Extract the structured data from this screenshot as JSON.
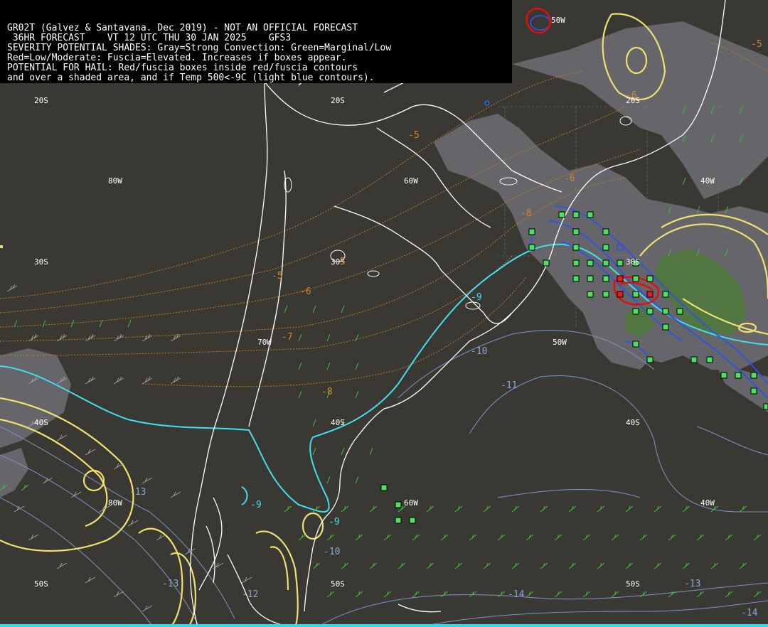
{
  "header": {
    "lines": [
      "GR02T (Galvez & Santavana. Dec 2019) - NOT AN OFFICIAL FORECAST",
      " 36HR FORECAST    VT 12 UTC THU 30 JAN 2025    GFS3",
      "SEVERITY POTENTIAL SHADES: Gray=Strong Convection: Green=Marginal/Low",
      "Red=Low/Moderate: Fuscia=Elevated. Increases if boxes appear.",
      "POTENTIAL FOR HAIL: Red/fuscia boxes inside red/fuscia contours",
      "and over a shaded area, and if Temp 500<-9C (light blue contours)."
    ]
  },
  "coord_labels": {
    "lat_20s_a": "20S",
    "lat_20s_b": "20S",
    "lat_20s_c": "20S",
    "lon_80w_a": "80W",
    "lon_60w_a": "60W",
    "lon_40w_a": "40W",
    "lon_50w_top": "50W",
    "lat_30s_a": "30S",
    "lat_30s_b": "30S",
    "lat_30s_c": "30S",
    "lon_70w": "70W",
    "lon_50w_a": "50W",
    "lat_40s_a": "40S",
    "lat_40s_b": "40S",
    "lat_40s_c": "40S",
    "lon_80w_b": "80W",
    "lon_60w_b": "60W",
    "lon_40w_b": "40W",
    "lat_50s_a": "50S",
    "lat_50s_b": "50S",
    "lat_50s_c": "50S"
  },
  "contour_labels": {
    "orange": [
      "-5",
      "-6",
      "-5",
      "-6",
      "-8",
      "-5",
      "-6",
      "-7",
      "-8",
      "-5"
    ],
    "cyan": [
      "-9",
      "-9",
      "-9"
    ],
    "steel": [
      "-10",
      "-11",
      "-13",
      "-10",
      "-12",
      "-14",
      "-13",
      "-14",
      "-13"
    ]
  },
  "colors": {
    "background": "#3a3833",
    "land_outline": "#ffffff",
    "temp_500_cyan": "#40e0f0",
    "temp_500_steel": "#8aa6d6",
    "temp_orange": "#d08a2a",
    "yellow_contour": "#f0e070",
    "blue_contour": "#2a55e6",
    "red_contour": "#e01010",
    "green_box": "#50e060",
    "red_box": "#e02020",
    "wind_green": "#40c040",
    "wind_gray": "#a0a0a0",
    "gray_shade": "#6a6a70"
  }
}
